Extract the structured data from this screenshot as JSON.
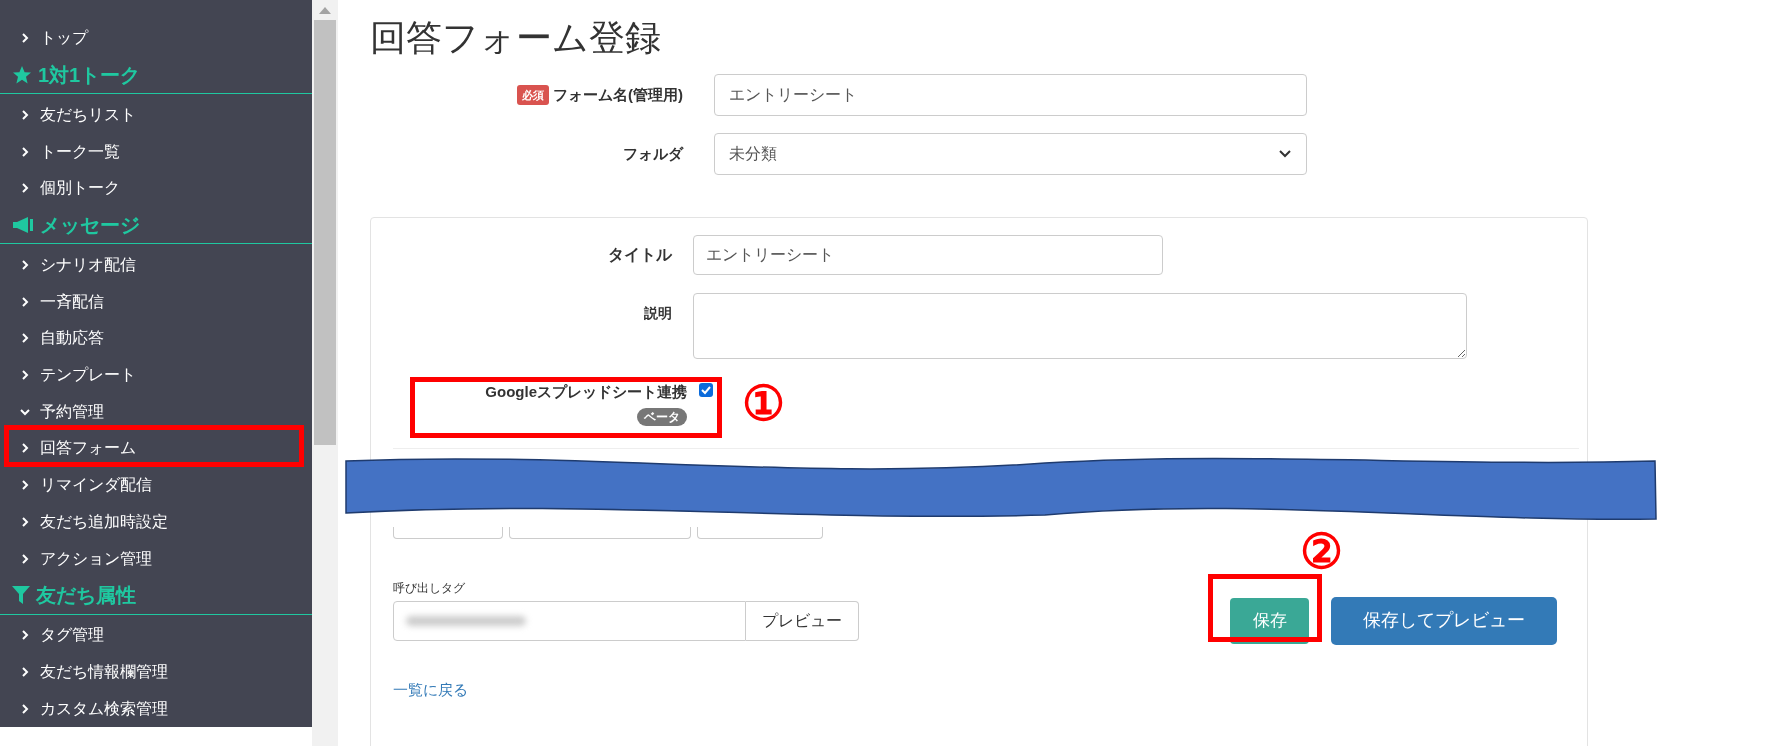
{
  "sidebar": {
    "items": [
      {
        "kind": "link",
        "label": "トップ",
        "expanded": false
      },
      {
        "kind": "heading",
        "label": "1対1トーク"
      },
      {
        "kind": "link",
        "label": "友だちリスト",
        "expanded": false
      },
      {
        "kind": "link",
        "label": "トーク一覧",
        "expanded": false
      },
      {
        "kind": "link",
        "label": "個別トーク",
        "expanded": false
      },
      {
        "kind": "heading",
        "label": "メッセージ"
      },
      {
        "kind": "link",
        "label": "シナリオ配信",
        "expanded": false
      },
      {
        "kind": "link",
        "label": "一斉配信",
        "expanded": false
      },
      {
        "kind": "link",
        "label": "自動応答",
        "expanded": false
      },
      {
        "kind": "link",
        "label": "テンプレート",
        "expanded": false
      },
      {
        "kind": "link",
        "label": "予約管理",
        "expanded": true
      },
      {
        "kind": "link",
        "label": "回答フォーム",
        "expanded": false
      },
      {
        "kind": "link",
        "label": "リマインダ配信",
        "expanded": false
      },
      {
        "kind": "link",
        "label": "友だち追加時設定",
        "expanded": false
      },
      {
        "kind": "link",
        "label": "アクション管理",
        "expanded": false
      },
      {
        "kind": "heading",
        "label": "友だち属性"
      },
      {
        "kind": "link",
        "label": "タグ管理",
        "expanded": false
      },
      {
        "kind": "link",
        "label": "友だち情報欄管理",
        "expanded": false
      },
      {
        "kind": "link",
        "label": "カスタム検索管理",
        "expanded": false
      }
    ]
  },
  "page_title": "回答フォーム登録",
  "form_name": {
    "badge": "必須",
    "label": "フォーム名(管理用)",
    "value": "エントリーシート"
  },
  "folder": {
    "label": "フォルダ",
    "value": "未分類"
  },
  "panel": {
    "title": {
      "label": "タイトル",
      "value": "エントリーシート"
    },
    "description": {
      "label": "説明"
    },
    "google_sheets": {
      "label": "Googleスプレッドシート連携",
      "badge": "ベータ",
      "checked": true
    },
    "call_tag": {
      "label": "呼び出しタグ",
      "button": "プレビュー"
    },
    "save_button": "保存",
    "save_preview_button": "保存してプレビュー",
    "back_link": "一覧に戻る"
  },
  "annotations": [
    "①",
    "②"
  ]
}
